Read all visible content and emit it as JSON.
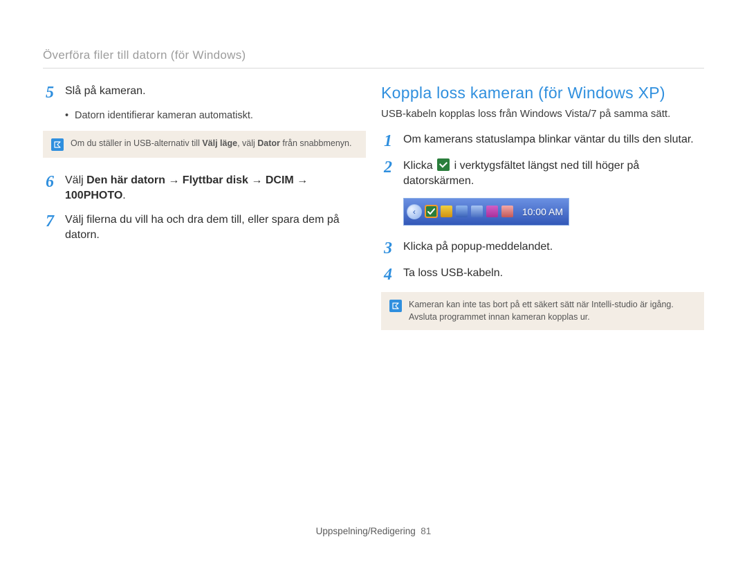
{
  "breadcrumb": "Överföra filer till datorn (för Windows)",
  "left": {
    "steps": [
      {
        "num": "5",
        "text": "Slå på kameran.",
        "bullets": [
          "Datorn identifierar kameran automatiskt."
        ]
      }
    ],
    "note": {
      "pre": "Om du ställer in USB-alternativ till ",
      "bold1": "Välj läge",
      "mid": ", välj ",
      "bold2": "Dator",
      "post": " från snabbmenyn."
    },
    "step6": {
      "num": "6",
      "pre": "Välj ",
      "bold": "Den här datorn → Flyttbar disk → DCIM → 100PHOTO",
      "post": "."
    },
    "step7": {
      "num": "7",
      "text": "Välj filerna du vill ha och dra dem till, eller spara dem på datorn."
    }
  },
  "right": {
    "title": "Koppla loss kameran (för Windows XP)",
    "subnote": "USB-kabeln kopplas loss från Windows Vista/7 på samma sätt.",
    "step1": {
      "num": "1",
      "text": "Om kamerans statuslampa blinkar väntar du tills den slutar."
    },
    "step2": {
      "num": "2",
      "pre": "Klicka ",
      "post": " i verktygsfältet längst ned till höger på datorskärmen."
    },
    "tray_time": "10:00 AM",
    "step3": {
      "num": "3",
      "text": "Klicka på popup-meddelandet."
    },
    "step4": {
      "num": "4",
      "text": "Ta loss USB-kabeln."
    },
    "note": "Kameran kan inte tas bort på ett säkert sätt när Intelli-studio är igång. Avsluta programmet innan kameran kopplas ur."
  },
  "footer": {
    "section": "Uppspelning/Redigering",
    "page": "81"
  }
}
